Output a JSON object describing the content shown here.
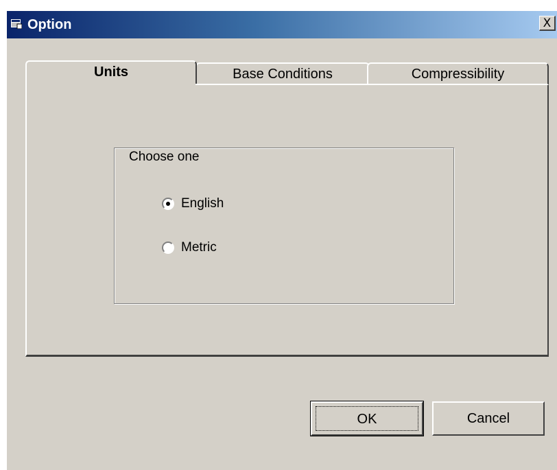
{
  "window": {
    "title": "Option",
    "close_label": "X",
    "titlebar_gradient": [
      "#0a246a",
      "#a6caf0"
    ],
    "face_color": "#d4d0c8"
  },
  "tabs": [
    {
      "label": "Units",
      "active": true
    },
    {
      "label": "Base Conditions",
      "active": false
    },
    {
      "label": "Compressibility",
      "active": false
    }
  ],
  "units_group": {
    "legend": "Choose one",
    "options": [
      {
        "label": "English",
        "selected": true
      },
      {
        "label": "Metric",
        "selected": false
      }
    ]
  },
  "buttons": {
    "ok_label": "OK",
    "cancel_label": "Cancel"
  }
}
